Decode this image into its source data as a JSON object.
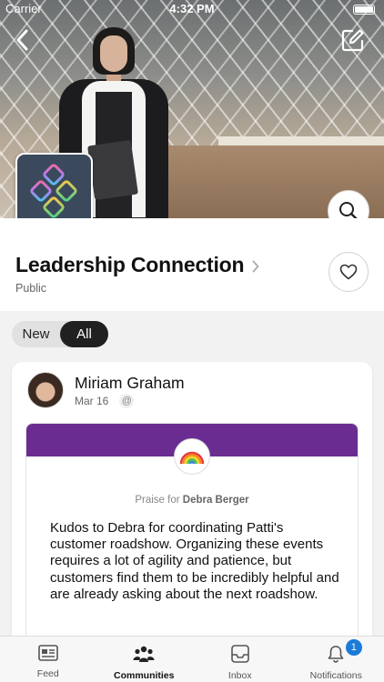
{
  "status_bar": {
    "carrier": "Carrier",
    "time": "4:32 PM"
  },
  "navigation": {
    "back_icon": "chevron-left-icon",
    "compose_icon": "compose-icon",
    "search_icon": "search-icon"
  },
  "community": {
    "name": "Leadership Connection",
    "privacy": "Public",
    "follow_icon": "heart-icon"
  },
  "filter": {
    "options": [
      "New",
      "All"
    ],
    "selected": "All"
  },
  "post": {
    "author": "Miriam Graham",
    "date": "Mar 16",
    "mention_symbol": "@",
    "praise": {
      "badge_icon": "rainbow-icon",
      "label": "Praise for",
      "recipient": "Debra Berger",
      "band_color": "#6a2c91",
      "message": "Kudos to Debra for coordinating Patti's customer roadshow. Organizing these events requires a lot of agility and patience, but customers find them to be incredibly helpful and are already asking about the next roadshow."
    }
  },
  "tabbar": {
    "tabs": [
      {
        "label": "Feed",
        "icon": "feed-icon"
      },
      {
        "label": "Communities",
        "icon": "communities-icon",
        "active": true
      },
      {
        "label": "Inbox",
        "icon": "inbox-icon"
      },
      {
        "label": "Notifications",
        "icon": "bell-icon",
        "badge": "1"
      }
    ]
  },
  "colors": {
    "accent": "#1b7bd6",
    "active_toggle": "#202020"
  }
}
